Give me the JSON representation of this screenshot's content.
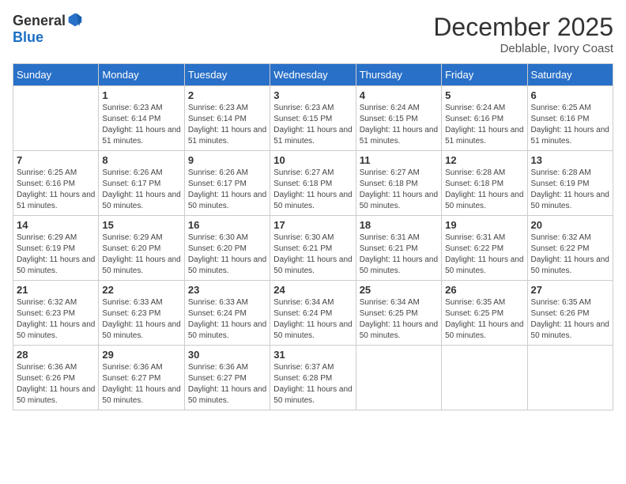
{
  "header": {
    "logo_general": "General",
    "logo_blue": "Blue",
    "month": "December 2025",
    "location": "Deblable, Ivory Coast"
  },
  "weekdays": [
    "Sunday",
    "Monday",
    "Tuesday",
    "Wednesday",
    "Thursday",
    "Friday",
    "Saturday"
  ],
  "weeks": [
    [
      {
        "day": "",
        "sunrise": "",
        "sunset": "",
        "daylight": ""
      },
      {
        "day": "1",
        "sunrise": "Sunrise: 6:23 AM",
        "sunset": "Sunset: 6:14 PM",
        "daylight": "Daylight: 11 hours and 51 minutes."
      },
      {
        "day": "2",
        "sunrise": "Sunrise: 6:23 AM",
        "sunset": "Sunset: 6:14 PM",
        "daylight": "Daylight: 11 hours and 51 minutes."
      },
      {
        "day": "3",
        "sunrise": "Sunrise: 6:23 AM",
        "sunset": "Sunset: 6:15 PM",
        "daylight": "Daylight: 11 hours and 51 minutes."
      },
      {
        "day": "4",
        "sunrise": "Sunrise: 6:24 AM",
        "sunset": "Sunset: 6:15 PM",
        "daylight": "Daylight: 11 hours and 51 minutes."
      },
      {
        "day": "5",
        "sunrise": "Sunrise: 6:24 AM",
        "sunset": "Sunset: 6:16 PM",
        "daylight": "Daylight: 11 hours and 51 minutes."
      },
      {
        "day": "6",
        "sunrise": "Sunrise: 6:25 AM",
        "sunset": "Sunset: 6:16 PM",
        "daylight": "Daylight: 11 hours and 51 minutes."
      }
    ],
    [
      {
        "day": "7",
        "sunrise": "Sunrise: 6:25 AM",
        "sunset": "Sunset: 6:16 PM",
        "daylight": "Daylight: 11 hours and 51 minutes."
      },
      {
        "day": "8",
        "sunrise": "Sunrise: 6:26 AM",
        "sunset": "Sunset: 6:17 PM",
        "daylight": "Daylight: 11 hours and 50 minutes."
      },
      {
        "day": "9",
        "sunrise": "Sunrise: 6:26 AM",
        "sunset": "Sunset: 6:17 PM",
        "daylight": "Daylight: 11 hours and 50 minutes."
      },
      {
        "day": "10",
        "sunrise": "Sunrise: 6:27 AM",
        "sunset": "Sunset: 6:18 PM",
        "daylight": "Daylight: 11 hours and 50 minutes."
      },
      {
        "day": "11",
        "sunrise": "Sunrise: 6:27 AM",
        "sunset": "Sunset: 6:18 PM",
        "daylight": "Daylight: 11 hours and 50 minutes."
      },
      {
        "day": "12",
        "sunrise": "Sunrise: 6:28 AM",
        "sunset": "Sunset: 6:18 PM",
        "daylight": "Daylight: 11 hours and 50 minutes."
      },
      {
        "day": "13",
        "sunrise": "Sunrise: 6:28 AM",
        "sunset": "Sunset: 6:19 PM",
        "daylight": "Daylight: 11 hours and 50 minutes."
      }
    ],
    [
      {
        "day": "14",
        "sunrise": "Sunrise: 6:29 AM",
        "sunset": "Sunset: 6:19 PM",
        "daylight": "Daylight: 11 hours and 50 minutes."
      },
      {
        "day": "15",
        "sunrise": "Sunrise: 6:29 AM",
        "sunset": "Sunset: 6:20 PM",
        "daylight": "Daylight: 11 hours and 50 minutes."
      },
      {
        "day": "16",
        "sunrise": "Sunrise: 6:30 AM",
        "sunset": "Sunset: 6:20 PM",
        "daylight": "Daylight: 11 hours and 50 minutes."
      },
      {
        "day": "17",
        "sunrise": "Sunrise: 6:30 AM",
        "sunset": "Sunset: 6:21 PM",
        "daylight": "Daylight: 11 hours and 50 minutes."
      },
      {
        "day": "18",
        "sunrise": "Sunrise: 6:31 AM",
        "sunset": "Sunset: 6:21 PM",
        "daylight": "Daylight: 11 hours and 50 minutes."
      },
      {
        "day": "19",
        "sunrise": "Sunrise: 6:31 AM",
        "sunset": "Sunset: 6:22 PM",
        "daylight": "Daylight: 11 hours and 50 minutes."
      },
      {
        "day": "20",
        "sunrise": "Sunrise: 6:32 AM",
        "sunset": "Sunset: 6:22 PM",
        "daylight": "Daylight: 11 hours and 50 minutes."
      }
    ],
    [
      {
        "day": "21",
        "sunrise": "Sunrise: 6:32 AM",
        "sunset": "Sunset: 6:23 PM",
        "daylight": "Daylight: 11 hours and 50 minutes."
      },
      {
        "day": "22",
        "sunrise": "Sunrise: 6:33 AM",
        "sunset": "Sunset: 6:23 PM",
        "daylight": "Daylight: 11 hours and 50 minutes."
      },
      {
        "day": "23",
        "sunrise": "Sunrise: 6:33 AM",
        "sunset": "Sunset: 6:24 PM",
        "daylight": "Daylight: 11 hours and 50 minutes."
      },
      {
        "day": "24",
        "sunrise": "Sunrise: 6:34 AM",
        "sunset": "Sunset: 6:24 PM",
        "daylight": "Daylight: 11 hours and 50 minutes."
      },
      {
        "day": "25",
        "sunrise": "Sunrise: 6:34 AM",
        "sunset": "Sunset: 6:25 PM",
        "daylight": "Daylight: 11 hours and 50 minutes."
      },
      {
        "day": "26",
        "sunrise": "Sunrise: 6:35 AM",
        "sunset": "Sunset: 6:25 PM",
        "daylight": "Daylight: 11 hours and 50 minutes."
      },
      {
        "day": "27",
        "sunrise": "Sunrise: 6:35 AM",
        "sunset": "Sunset: 6:26 PM",
        "daylight": "Daylight: 11 hours and 50 minutes."
      }
    ],
    [
      {
        "day": "28",
        "sunrise": "Sunrise: 6:36 AM",
        "sunset": "Sunset: 6:26 PM",
        "daylight": "Daylight: 11 hours and 50 minutes."
      },
      {
        "day": "29",
        "sunrise": "Sunrise: 6:36 AM",
        "sunset": "Sunset: 6:27 PM",
        "daylight": "Daylight: 11 hours and 50 minutes."
      },
      {
        "day": "30",
        "sunrise": "Sunrise: 6:36 AM",
        "sunset": "Sunset: 6:27 PM",
        "daylight": "Daylight: 11 hours and 50 minutes."
      },
      {
        "day": "31",
        "sunrise": "Sunrise: 6:37 AM",
        "sunset": "Sunset: 6:28 PM",
        "daylight": "Daylight: 11 hours and 50 minutes."
      },
      {
        "day": "",
        "sunrise": "",
        "sunset": "",
        "daylight": ""
      },
      {
        "day": "",
        "sunrise": "",
        "sunset": "",
        "daylight": ""
      },
      {
        "day": "",
        "sunrise": "",
        "sunset": "",
        "daylight": ""
      }
    ]
  ]
}
